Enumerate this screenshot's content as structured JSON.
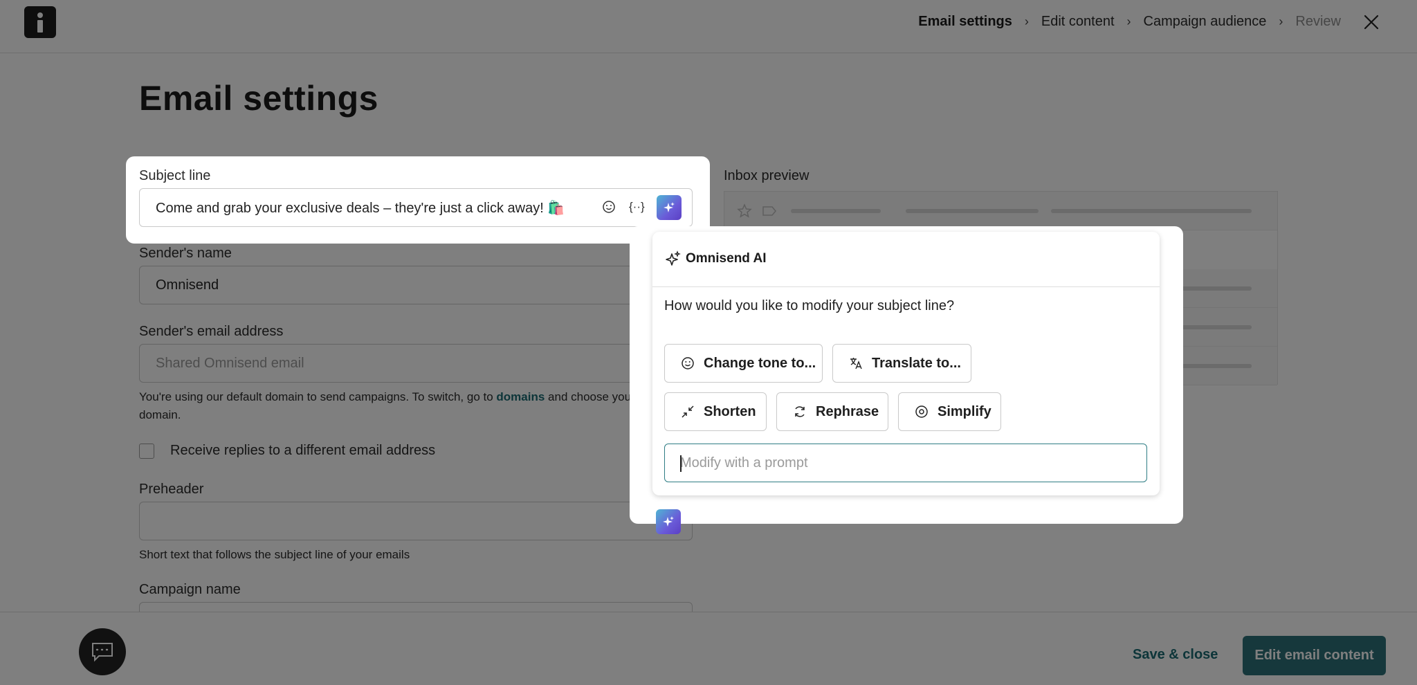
{
  "header": {
    "breadcrumbs": [
      "Email settings",
      "Edit content",
      "Campaign audience",
      "Review"
    ],
    "close_icon": "close-icon",
    "logo_icon": "omnisend-logo"
  },
  "page": {
    "title": "Email settings"
  },
  "form": {
    "subject": {
      "label": "Subject line",
      "value": "Come and grab your exclusive deals – they're just a click away! 🛍️"
    },
    "sender_name": {
      "label": "Sender's name",
      "value": "Omnisend"
    },
    "sender_email": {
      "label": "Sender's email address",
      "placeholder": "Shared Omnisend email",
      "helper_prefix": "You're using our default domain to send campaigns. To switch, go to ",
      "helper_link": "domains",
      "helper_suffix": " and choose your verified",
      "helper_line2": "domain."
    },
    "replies_checkbox": {
      "label": "Receive replies to a different email address",
      "checked": false
    },
    "preheader": {
      "label": "Preheader",
      "value": "",
      "helper": "Short text that follows the subject line of your emails"
    },
    "campaign_name": {
      "label": "Campaign name"
    }
  },
  "inbox_preview": {
    "label": "Inbox preview"
  },
  "ai_popup": {
    "title": "Omnisend AI",
    "question": "How would you like to modify your subject line?",
    "options": [
      {
        "label": "Change tone to...",
        "icon": "smiley-icon"
      },
      {
        "label": "Translate to...",
        "icon": "translate-icon"
      },
      {
        "label": "Shorten",
        "icon": "shrink-icon"
      },
      {
        "label": "Rephrase",
        "icon": "refresh-icon"
      },
      {
        "label": "Simplify",
        "icon": "target-icon"
      }
    ],
    "prompt_placeholder": "Modify with a prompt"
  },
  "footer": {
    "save_close_label": "Save & close",
    "edit_content_label": "Edit email content",
    "chat_icon": "chat-icon"
  },
  "colors": {
    "accent": "#2c7178",
    "link": "#1a6b72",
    "overlay": "rgba(0,0,0,0.5)"
  }
}
